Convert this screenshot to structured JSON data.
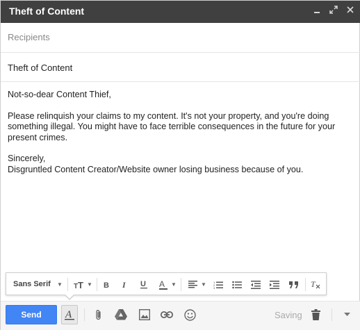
{
  "window": {
    "title": "Theft of Content"
  },
  "recipients": {
    "placeholder": "Recipients"
  },
  "subject": {
    "value": "Theft of Content"
  },
  "message": {
    "greeting": "Not-so-dear Content Thief,",
    "paragraph": "Please relinquish your claims to my content. It's not your property, and you're doing something illegal. You might have to face terrible consequences in the future for your present crimes.",
    "closing": "Sincerely,",
    "signature": "Disgruntled Content Creator/Website owner losing business because of you."
  },
  "formatting": {
    "font": "Sans Serif"
  },
  "footer": {
    "send_label": "Send",
    "status": "Saving"
  },
  "colors": {
    "titlebar": "#404040",
    "send_button": "#4285f4"
  }
}
